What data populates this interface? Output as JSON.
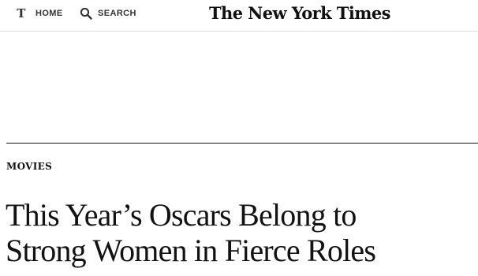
{
  "header": {
    "home_label": "HOME",
    "search_label": "SEARCH",
    "masthead": "The New York Times",
    "logo_glyph": "T",
    "icons": {
      "logo": "nyt-t-logo-icon",
      "search": "search-icon"
    }
  },
  "article": {
    "section": "MOVIES",
    "headline_line1": "This Year’s Oscars Belong to",
    "headline_line2": "Strong Women in Fierce Roles"
  }
}
